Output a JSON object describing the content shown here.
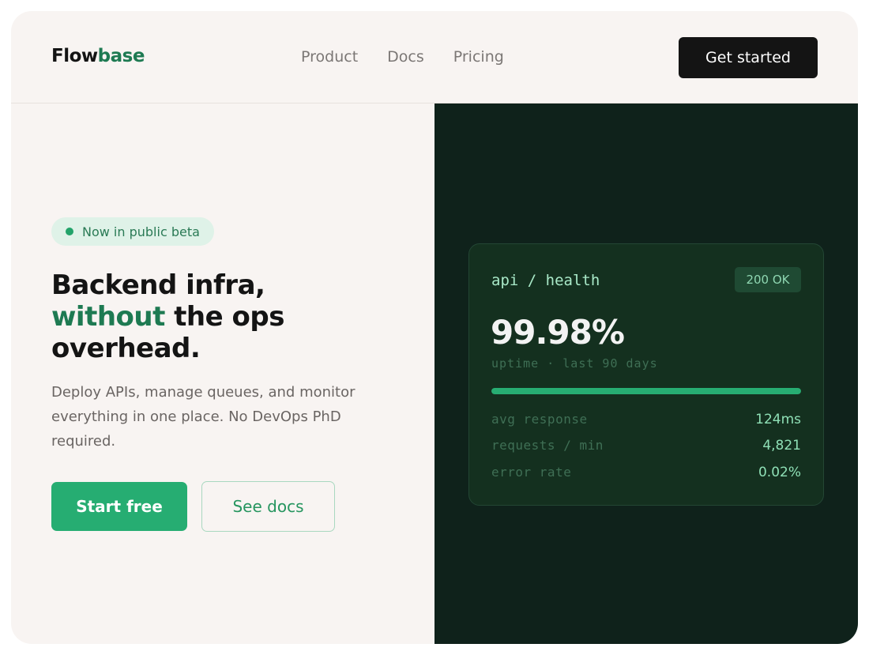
{
  "brand": {
    "name_part1": "Flow",
    "name_part2": "base"
  },
  "nav": {
    "items": [
      "Product",
      "Docs",
      "Pricing"
    ]
  },
  "header_cta": "Get started",
  "hero": {
    "badge": "Now in public beta",
    "headline_line1": "Backend infra,",
    "headline_green": "without",
    "headline_rest": " the ops",
    "headline_line3": "overhead.",
    "subtext": "Deploy APIs, manage queues, and monitor everything in one place. No DevOps PhD required.",
    "primary_cta": "Start free",
    "secondary_cta": "See docs"
  },
  "card": {
    "title": "api / health",
    "status": "200 OK",
    "uptime_value": "99.98%",
    "uptime_caption": "uptime · last 90 days",
    "uptime_fraction": 0.9998,
    "stats": [
      {
        "label": "avg response",
        "value": "124ms"
      },
      {
        "label": "requests / min",
        "value": "4,821"
      },
      {
        "label": "error rate",
        "value": "0.02%"
      }
    ]
  },
  "colors": {
    "accent_green": "#26ad72",
    "brand_green": "#1e7a52",
    "dark_panel": "#0f221b",
    "page_bg": "#f8f4f2"
  }
}
